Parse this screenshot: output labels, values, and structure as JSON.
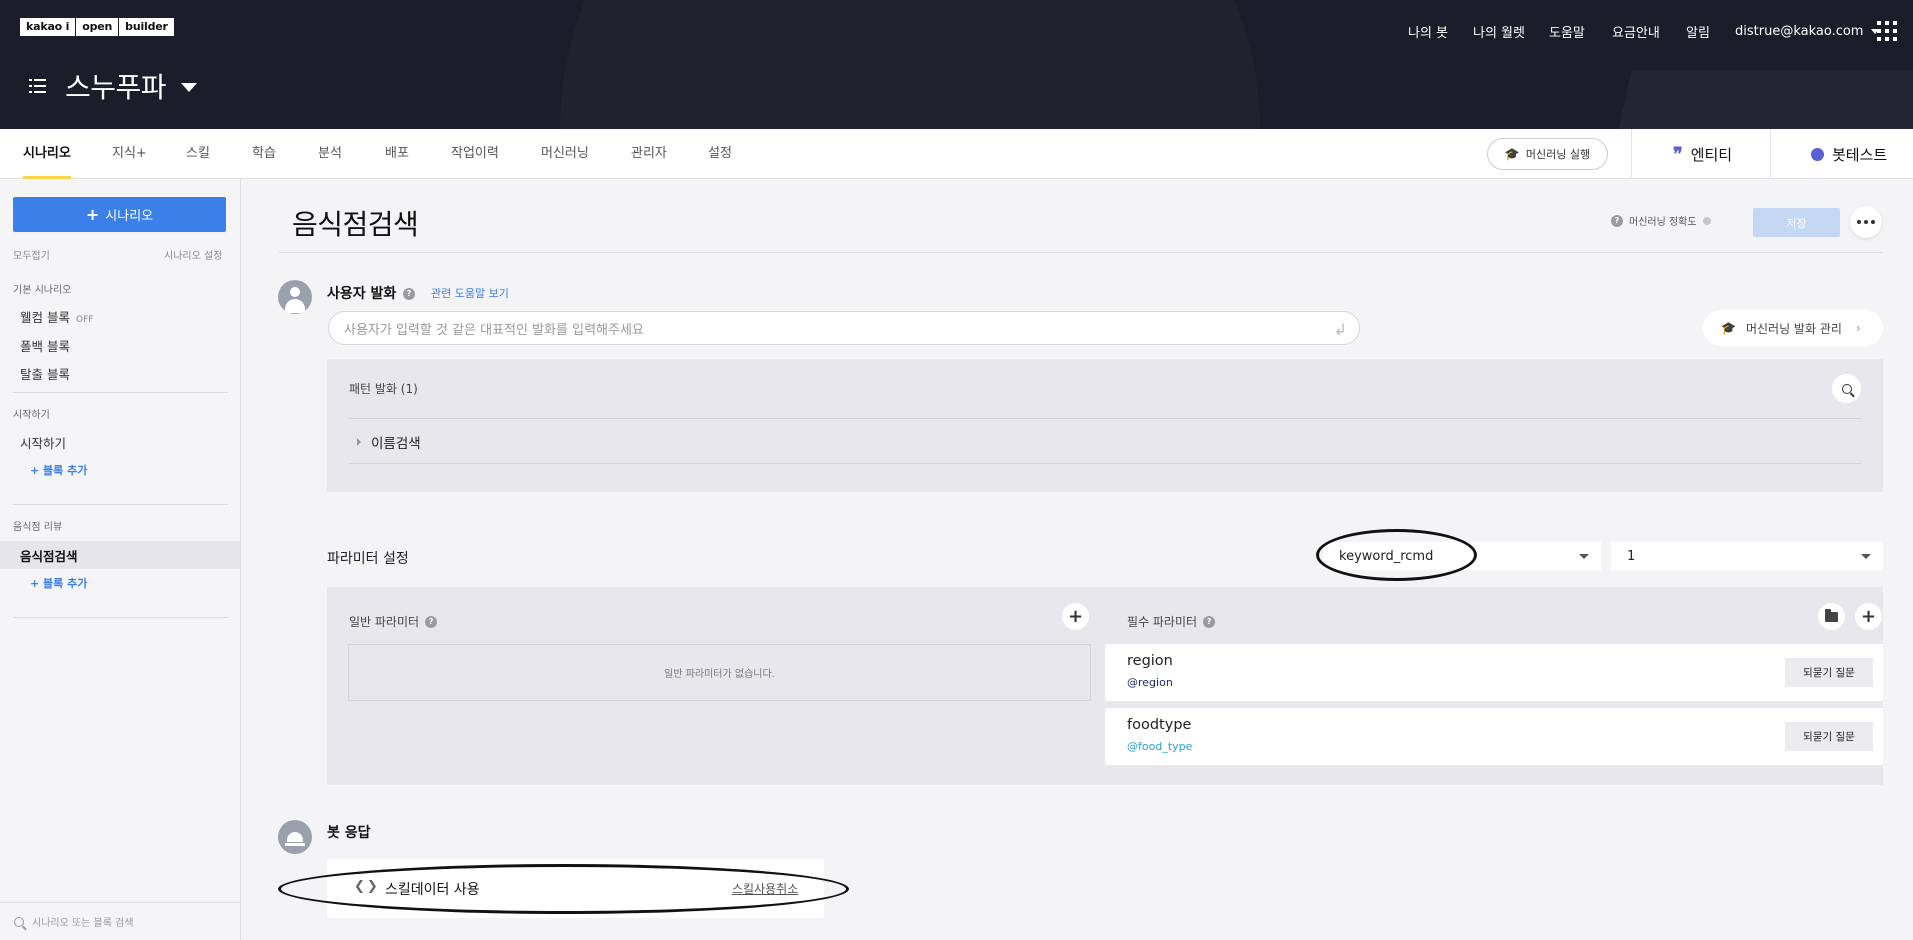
{
  "header": {
    "logo": [
      "kakao i",
      "open",
      "builder"
    ],
    "bot_name": "스누푸파",
    "nav": [
      "나의 봇",
      "나의 월렛",
      "도움말",
      "요금안내",
      "알림"
    ],
    "user_email": "distrue@kakao.com"
  },
  "tabs": [
    "시나리오",
    "지식+",
    "스킬",
    "학습",
    "분석",
    "배포",
    "작업이력",
    "머신러닝",
    "관리자",
    "설정"
  ],
  "toolbar": {
    "ml_run": "머신러닝 실행",
    "entity": "엔티티",
    "bottest": "봇테스트"
  },
  "sidebar": {
    "add_scenario": "시나리오",
    "collapse_all": "모두접기",
    "scenario_settings": "시나리오 설정",
    "groups": [
      {
        "title": "기본 시나리오",
        "items": [
          "웰컴 블록",
          "폴백 블록",
          "탈출 블록"
        ],
        "off_badge": "OFF"
      },
      {
        "title": "시작하기",
        "items": [
          "시작하기"
        ],
        "add_block": "+ 블록 추가"
      },
      {
        "title": "음식점 리뷰",
        "items": [
          "음식점검색"
        ],
        "add_block": "+ 블록 추가"
      }
    ],
    "search_placeholder": "시나리오 또는 블록 검색"
  },
  "block": {
    "title": "음식점검색",
    "ml_accuracy": "머신러닝 정확도",
    "save": "저장"
  },
  "user_utterance": {
    "label": "사용자 발화",
    "help_link": "관련 도움말 보기",
    "placeholder": "사용자가 입력할 것 같은 대표적인 발화를 입력해주세요",
    "ml_manage": "머신러닝 발화 관리",
    "pattern_title": "패턴 발화 (1)",
    "patterns": [
      "이름검색"
    ]
  },
  "params": {
    "title": "파라미터 설정",
    "skill_select": "keyword_rcmd",
    "version_select": "1",
    "general_label": "일반 파라미터",
    "general_empty": "일반 파라미터가 없습니다.",
    "required_label": "필수 파라미터",
    "required": [
      {
        "name": "region",
        "entity": "@region",
        "entity_color": "#1a2a6c",
        "reask": "되묻기 질문"
      },
      {
        "name": "foodtype",
        "entity": "@food_type",
        "entity_color": "#2a9fd6",
        "reask": "되묻기 질문"
      }
    ]
  },
  "bot_response": {
    "label": "봇 응답",
    "skill_data": "스킬데이터 사용",
    "skill_cancel": "스킬사용취소"
  },
  "colors": {
    "header_bg": "#1c1c2a",
    "primary": "#3b80e8",
    "tab_active": "#f7d64a",
    "ml_accent": "#5a5fd6"
  }
}
